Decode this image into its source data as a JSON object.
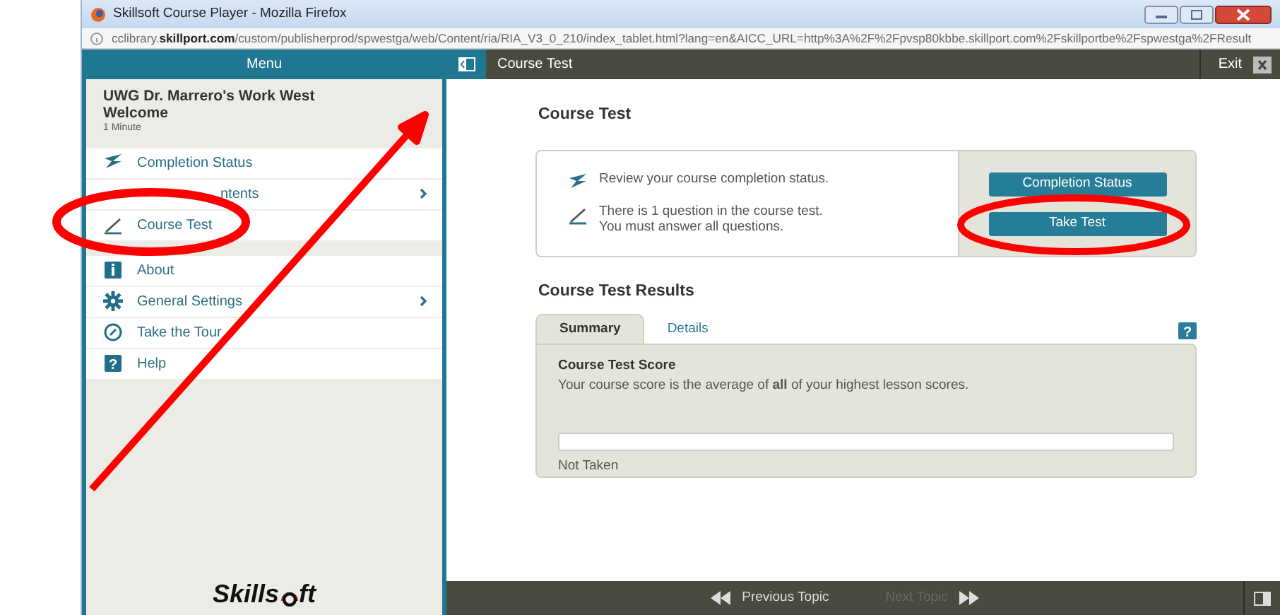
{
  "window": {
    "title": "Skillsoft Course Player - Mozilla Firefox",
    "url_host": "cclibrary.",
    "url_domain": "skillport.com",
    "url_path": "/custom/publisherprod/spwestga/web/Content/ria/RIA_V3_0_210/index_tablet.html?lang=en&AICC_URL=http%3A%2F%2Fpvsp80kbbe.skillport.com%2Fskillportbe%2Fspwestga%2FResult"
  },
  "header": {
    "menu_label": "Menu",
    "page_title": "Course Test",
    "exit_label": "Exit"
  },
  "sidebar": {
    "course_title": "UWG Dr. Marrero's Work West Welcome",
    "duration": "1 Minute",
    "sections": [
      [
        {
          "label": "Completion Status",
          "chevron": false
        },
        {
          "label": "ntents",
          "chevron": true
        },
        {
          "label": "Course Test",
          "chevron": false
        }
      ],
      [
        {
          "label": "About",
          "chevron": false
        },
        {
          "label": "General Settings",
          "chevron": true
        },
        {
          "label": "Take the Tour",
          "chevron": false
        },
        {
          "label": "Help",
          "chevron": false
        }
      ]
    ],
    "logo": "Skills",
    "logo_end": "ft"
  },
  "main": {
    "heading": "Course Test",
    "tasks": [
      {
        "text": "Review your course completion status.",
        "button": "Completion Status"
      },
      {
        "text": "There is 1 question in the course test.\nYou must answer all questions.",
        "button": "Take Test"
      }
    ],
    "results_heading": "Course Test Results",
    "tabs": [
      {
        "label": "Summary",
        "selected": true
      },
      {
        "label": "Details",
        "selected": false
      }
    ],
    "help": "?",
    "score_title": "Course Test Score",
    "score_text": "Your course score is the average of **all** of your highest lesson scores.",
    "score_bar": {
      "level": 0
    },
    "score_status": "Not Taken"
  },
  "footer": {
    "previous": "Previous Topic",
    "next": "Next Topic",
    "next_disabled": true
  }
}
